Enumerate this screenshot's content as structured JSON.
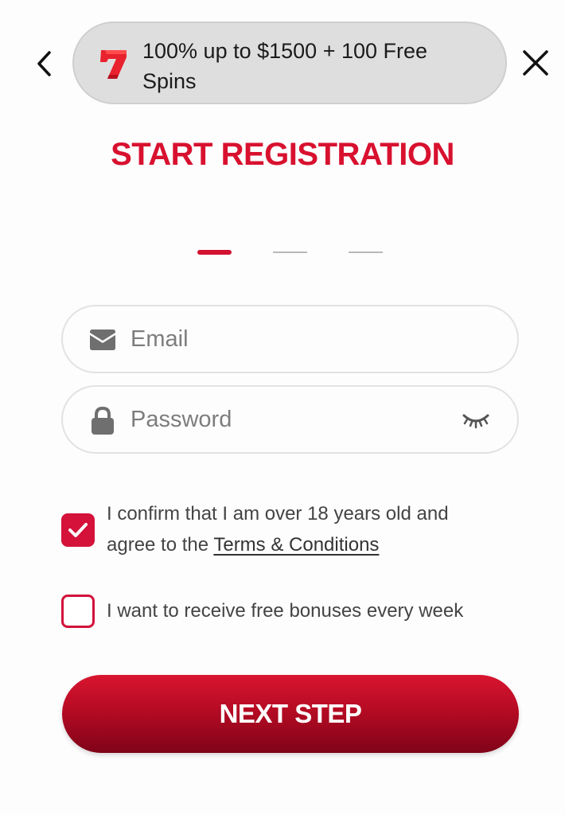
{
  "header": {
    "back_icon": "chevron-left-icon",
    "close_icon": "close-icon",
    "promo": {
      "logo_icon": "lucky-seven-icon",
      "text": "100% up to $1500 + 100 Free Spins"
    }
  },
  "title": "START REGISTRATION",
  "steps": {
    "current": 1,
    "total": 3
  },
  "form": {
    "email": {
      "icon": "envelope-icon",
      "placeholder": "Email",
      "value": ""
    },
    "password": {
      "icon": "lock-icon",
      "placeholder": "Password",
      "value": "",
      "toggle_icon": "eye-closed-icon"
    },
    "age_confirm": {
      "checked": true,
      "text_before": "I confirm that I am over 18 years old and agree to the ",
      "link": "Terms & Conditions"
    },
    "bonuses": {
      "checked": false,
      "text": "I want to receive free bonuses every week"
    }
  },
  "next_button": "NEXT STEP",
  "colors": {
    "brand_red": "#d8112f",
    "button_dark": "#800318",
    "pill_gray": "#dedede"
  }
}
